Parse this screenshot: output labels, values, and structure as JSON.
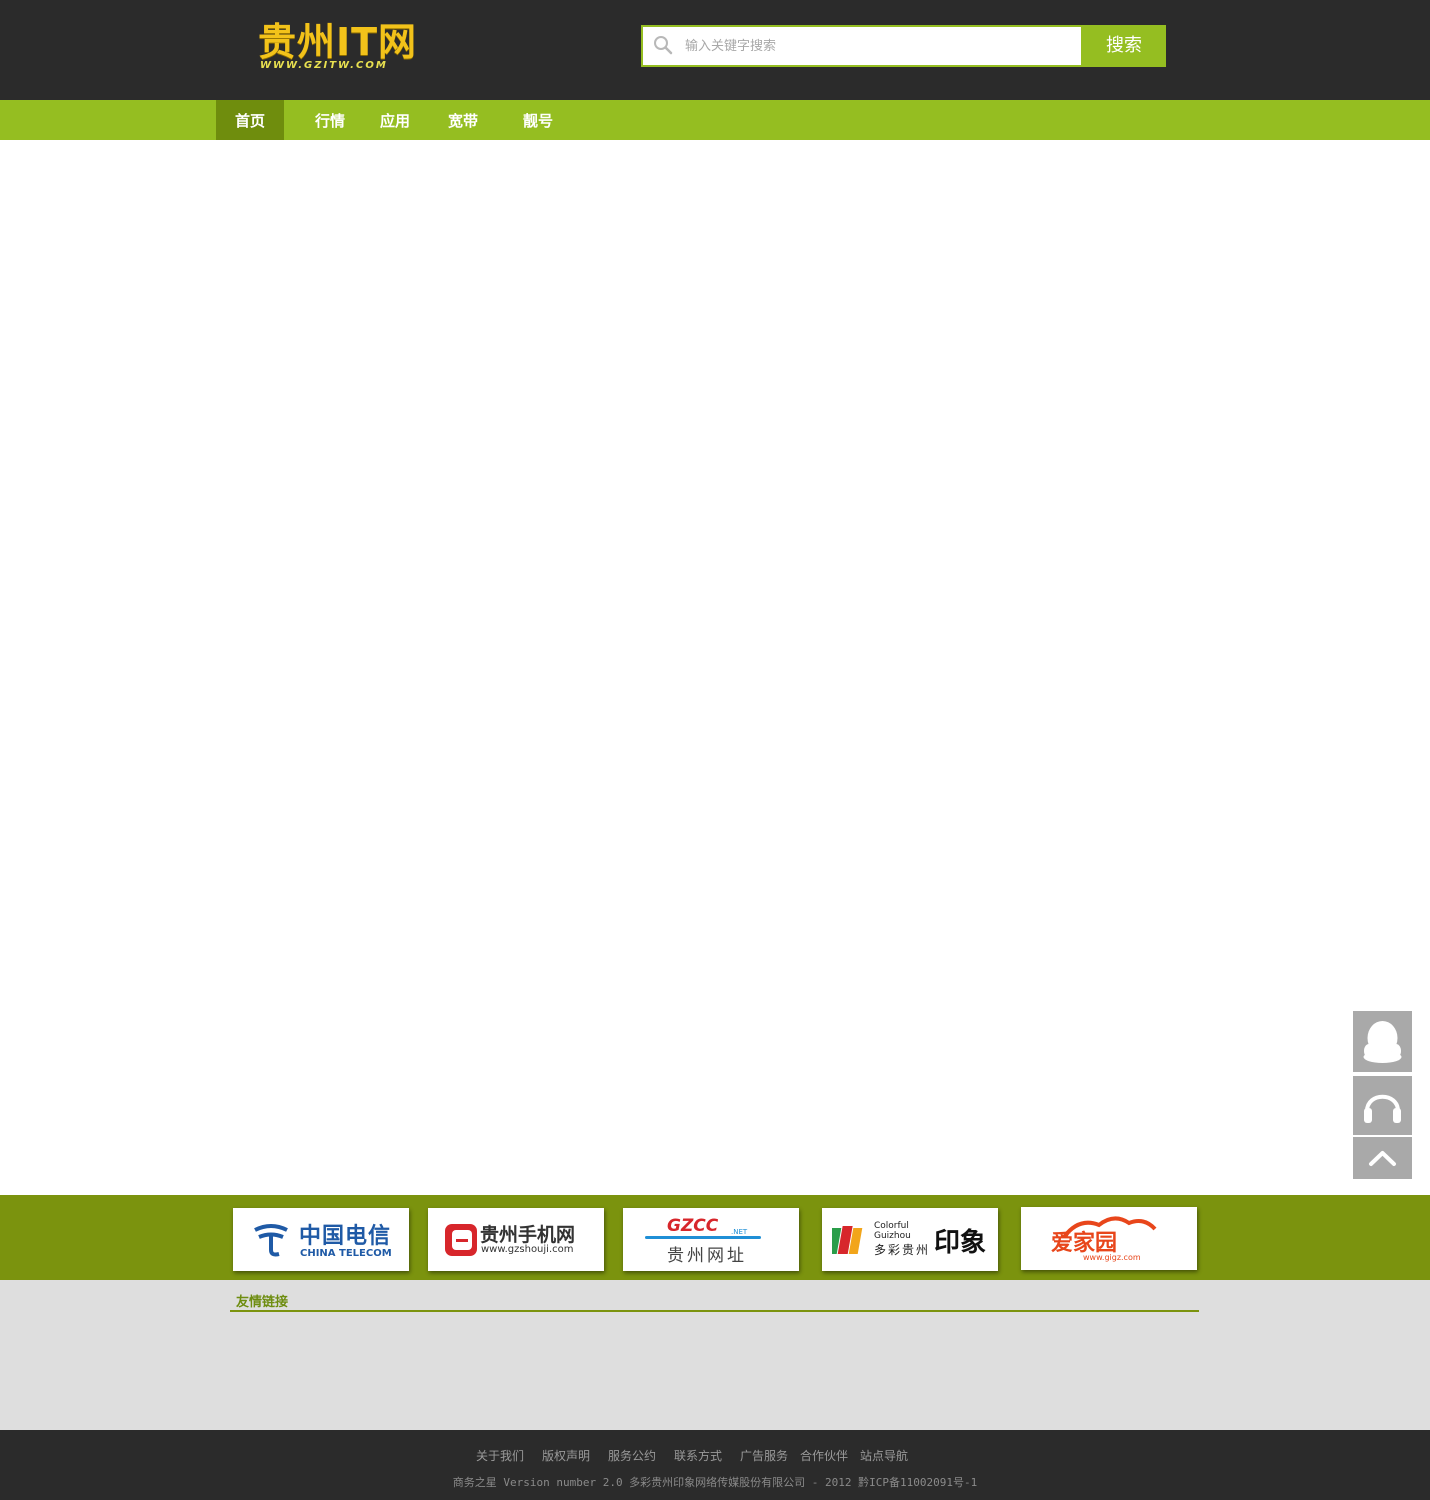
{
  "header": {
    "logo_text": "贵州IT网",
    "logo_subtext": "WWW.GZITW.COM",
    "search_placeholder": "输入关键字搜索",
    "search_button": "搜索"
  },
  "nav": {
    "items": [
      {
        "label": "首页"
      },
      {
        "label": "行情"
      },
      {
        "label": "应用"
      },
      {
        "label": "宽带"
      },
      {
        "label": "靓号"
      }
    ]
  },
  "partners": {
    "items": [
      {
        "main": "中国电信",
        "sub": "CHINA TELECOM"
      },
      {
        "main": "贵州手机网",
        "sub": "www.gzshouji.com"
      },
      {
        "main": "贵州网址",
        "badge": "GZCC",
        "sub": ".NET"
      },
      {
        "main": "多彩贵州",
        "brand": "印象",
        "sub": "Colorful Guizhou"
      },
      {
        "main": "爱家园",
        "sub": "www.gigz.com"
      }
    ]
  },
  "links": {
    "title": "友情链接"
  },
  "footer": {
    "links": [
      "关于我们",
      "版权声明",
      "服务公约",
      "联系方式",
      "广告服务",
      "合作伙伴",
      "站点导航"
    ],
    "copyright": "商务之星 Version number 2.0  多彩贵州印象网络传媒股份有限公司 - 2012  黔ICP备11002091号-1"
  },
  "colors": {
    "header_bg": "#2b2b2b",
    "accent_green": "#95be21",
    "dark_green": "#7b930e",
    "nav_active": "#6f8d0d",
    "links_bg": "#dedede",
    "float_btn": "#a9a9a9"
  },
  "icons": {
    "search": "magnifier-icon",
    "qq": "qq-penguin-icon",
    "support": "headset-icon",
    "top": "chevron-up-icon"
  }
}
